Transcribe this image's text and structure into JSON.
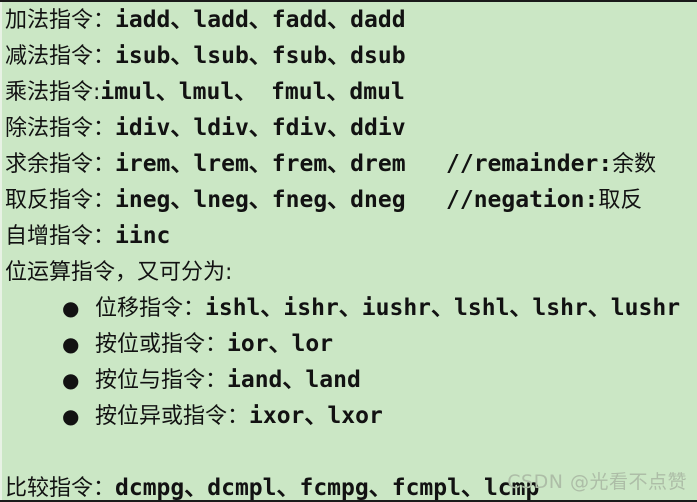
{
  "slide": {
    "background_color": "#cbe7c5",
    "text_color": "#121212",
    "border_color": "#1a1a1a"
  },
  "top_lines": [
    {
      "label": "加法指令：",
      "ops": "iadd、ladd、fadd、dadd"
    },
    {
      "label": "减法指令：",
      "ops": "isub、lsub、fsub、dsub"
    },
    {
      "label": "乘法指令:",
      "ops": "imul、lmul、 fmul、dmul"
    },
    {
      "label": "除法指令：",
      "ops": "idiv、ldiv、fdiv、ddiv"
    },
    {
      "label": "求余指令：",
      "ops": "irem、lrem、frem、drem"
    },
    {
      "label": "取反指令：",
      "ops": "ineg、lneg、fneg、dneg"
    },
    {
      "label": "自增指令：",
      "ops": "iinc"
    }
  ],
  "comments": [
    {
      "code": "//remainder:",
      "cn": "余数"
    },
    {
      "code": "//negation:",
      "cn": "取反"
    }
  ],
  "bitwise_heading": "位运算指令，又可分为:",
  "bullet_marker": "●",
  "bullets": [
    {
      "label": "位移指令：",
      "ops": "ishl、ishr、iushr、lshl、lshr、lushr"
    },
    {
      "label": "按位或指令：",
      "ops": "ior、lor"
    },
    {
      "label": "按位与指令：",
      "ops": "iand、land"
    },
    {
      "label": "按位异或指令：",
      "ops": "ixor、lxor"
    }
  ],
  "compare_line": {
    "label": "比较指令：",
    "ops": "dcmpg、dcmpl、fcmpg、fcmpl、lcmp"
  },
  "watermark": "CSDN @光看不点赞"
}
